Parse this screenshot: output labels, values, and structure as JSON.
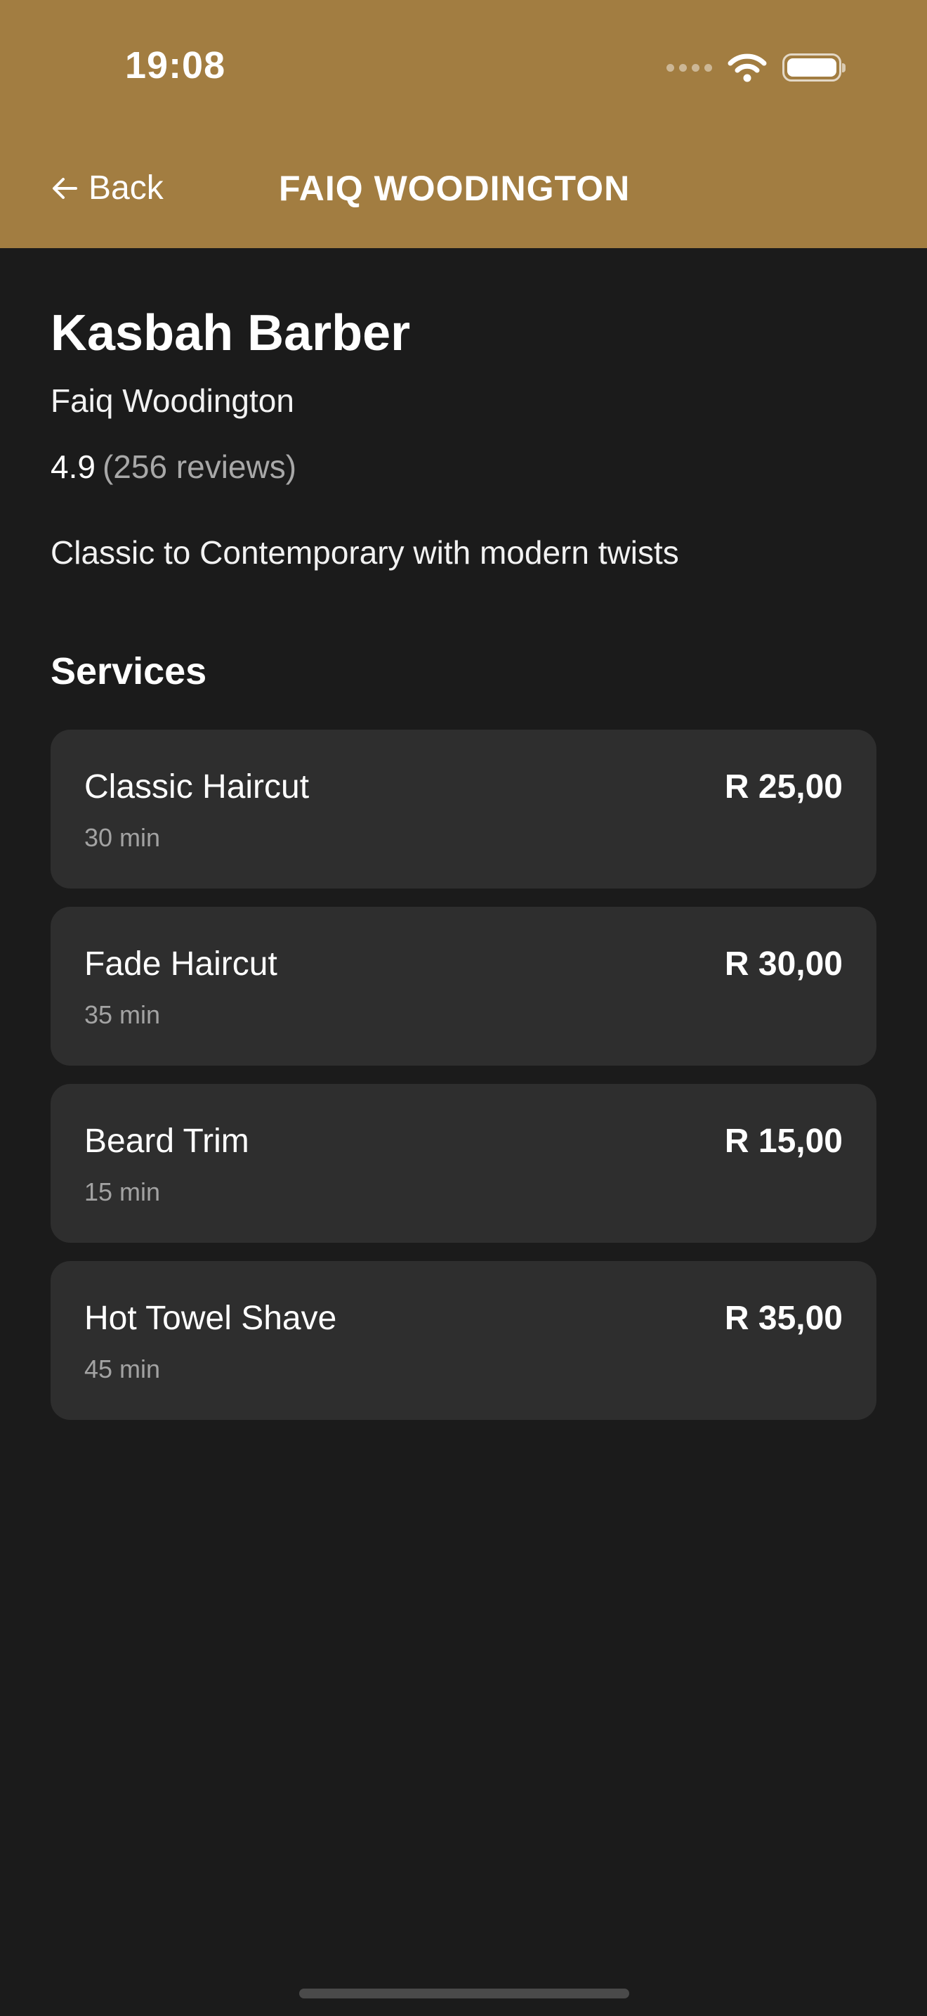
{
  "status_bar": {
    "time": "19:08",
    "icons": [
      "cellular-icon",
      "wifi-icon",
      "battery-icon"
    ]
  },
  "header": {
    "back_label": "Back",
    "back_icon": "arrow-left-icon",
    "title": "FAIQ WOODINGTON"
  },
  "shop": {
    "name": "Kasbah Barber",
    "barber": "Faiq Woodington",
    "rating": "4.9",
    "reviews": "(256 reviews)",
    "tagline": "Classic to Contemporary with modern twists"
  },
  "services": {
    "title": "Services",
    "items": [
      {
        "name": "Classic Haircut",
        "duration": "30 min",
        "price": "R 25,00"
      },
      {
        "name": "Fade Haircut",
        "duration": "35 min",
        "price": "R 30,00"
      },
      {
        "name": "Beard Trim",
        "duration": "15 min",
        "price": "R 15,00"
      },
      {
        "name": "Hot Towel Shave",
        "duration": "45 min",
        "price": "R 35,00"
      }
    ]
  },
  "colors": {
    "header": "#a27d41",
    "background": "#1b1b1b",
    "card": "#2e2e2e",
    "muted_text": "#a3a3a3"
  }
}
